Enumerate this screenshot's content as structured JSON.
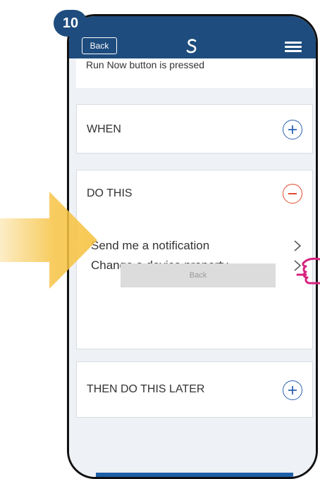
{
  "step": "10",
  "header": {
    "back_label": "Back"
  },
  "summary_text": "Run Now button is pressed",
  "sections": {
    "when": {
      "title": "WHEN"
    },
    "do_this": {
      "title": "DO THIS",
      "actions": [
        {
          "label": "Send me a notification"
        },
        {
          "label": "Change a device property"
        }
      ],
      "back_label": "Back"
    },
    "then_later": {
      "title": "THEN DO THIS LATER"
    }
  },
  "colors": {
    "header": "#1e4c7e",
    "add": "#2c62b4",
    "remove": "#e34a2f",
    "arrow": "#f6c343",
    "hand": "#d6227f"
  },
  "icons": [
    "logo-icon",
    "menu-icon",
    "plus-icon",
    "minus-icon",
    "chevron-right-icon",
    "arrow-icon",
    "hand-pointer-icon"
  ]
}
